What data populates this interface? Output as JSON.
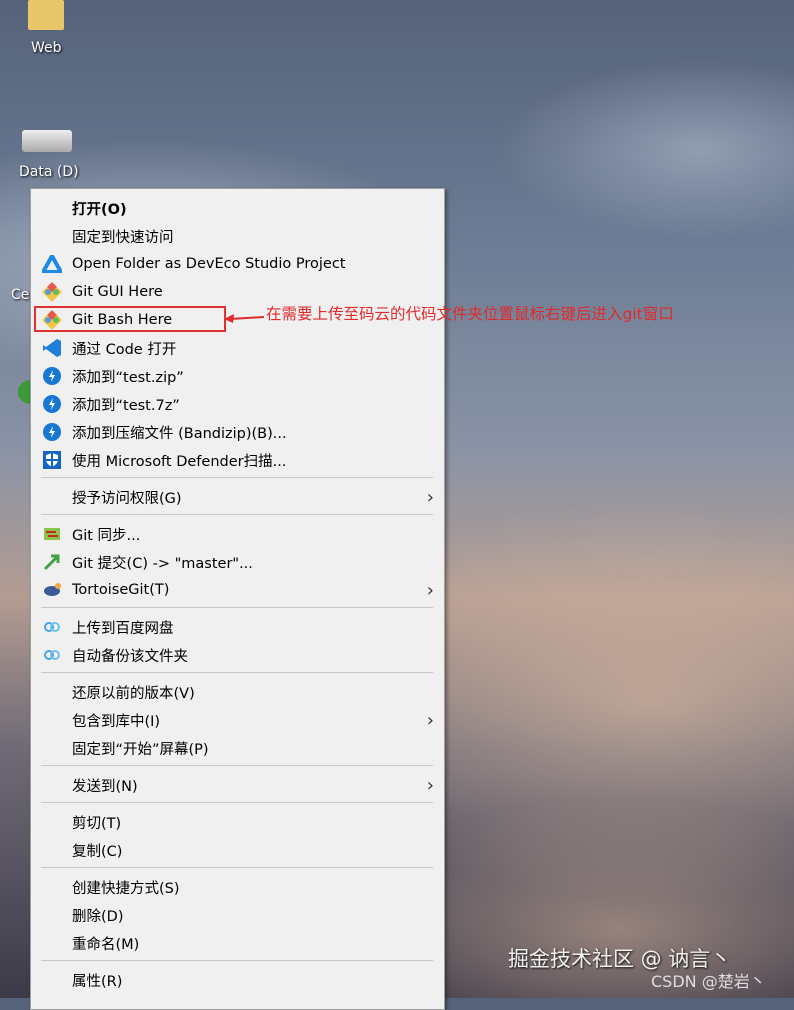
{
  "desktop": {
    "icons": [
      {
        "label": "Web"
      },
      {
        "label": "Data (D)"
      },
      {
        "label": "Ce"
      }
    ]
  },
  "menu": {
    "items": [
      {
        "type": "item",
        "label": "打开(O)",
        "bold": true,
        "icon": ""
      },
      {
        "type": "item",
        "label": "固定到快速访问",
        "icon": ""
      },
      {
        "type": "item",
        "label": "Open Folder as DevEco Studio Project",
        "icon": "deveco-icon"
      },
      {
        "type": "item",
        "label": "Git GUI Here",
        "icon": "git-icon"
      },
      {
        "type": "item",
        "label": "Git Bash Here",
        "icon": "git-icon"
      },
      {
        "type": "item",
        "label": "通过 Code 打开",
        "icon": "vscode-icon"
      },
      {
        "type": "item",
        "label": "添加到“test.zip”",
        "icon": "bandizip-icon"
      },
      {
        "type": "item",
        "label": "添加到“test.7z”",
        "icon": "bandizip-icon"
      },
      {
        "type": "item",
        "label": "添加到压缩文件 (Bandizip)(B)...",
        "icon": "bandizip-icon"
      },
      {
        "type": "item",
        "label": "使用 Microsoft Defender扫描...",
        "icon": "defender-icon"
      },
      {
        "type": "sep"
      },
      {
        "type": "item",
        "label": "授予访问权限(G)",
        "icon": "",
        "submenu": true
      },
      {
        "type": "sep"
      },
      {
        "type": "item",
        "label": "Git 同步...",
        "icon": "tortoisegit-sync-icon"
      },
      {
        "type": "item",
        "label": "Git 提交(C) -> \"master\"...",
        "icon": "tortoisegit-commit-icon"
      },
      {
        "type": "item",
        "label": "TortoiseGit(T)",
        "icon": "tortoisegit-icon",
        "submenu": true
      },
      {
        "type": "sep"
      },
      {
        "type": "item",
        "label": "上传到百度网盘",
        "icon": "baidu-netdisk-icon"
      },
      {
        "type": "item",
        "label": "自动备份该文件夹",
        "icon": "baidu-netdisk-icon"
      },
      {
        "type": "sep"
      },
      {
        "type": "item",
        "label": "还原以前的版本(V)",
        "icon": ""
      },
      {
        "type": "item",
        "label": "包含到库中(I)",
        "icon": "",
        "submenu": true
      },
      {
        "type": "item",
        "label": "固定到“开始”屏幕(P)",
        "icon": ""
      },
      {
        "type": "sep"
      },
      {
        "type": "item",
        "label": "发送到(N)",
        "icon": "",
        "submenu": true
      },
      {
        "type": "sep"
      },
      {
        "type": "item",
        "label": "剪切(T)",
        "icon": ""
      },
      {
        "type": "item",
        "label": "复制(C)",
        "icon": ""
      },
      {
        "type": "sep"
      },
      {
        "type": "item",
        "label": "创建快捷方式(S)",
        "icon": ""
      },
      {
        "type": "item",
        "label": "删除(D)",
        "icon": ""
      },
      {
        "type": "item",
        "label": "重命名(M)",
        "icon": ""
      },
      {
        "type": "sep"
      },
      {
        "type": "item",
        "label": "属性(R)",
        "icon": ""
      }
    ]
  },
  "annotation": {
    "text": "在需要上传至码云的代码文件夹位置鼠标右键后进入git窗口",
    "color": "#e02a2a"
  },
  "watermarks": {
    "juejin": "掘金技术社区 @ 讷言丶",
    "csdn": "CSDN @楚岩丶"
  }
}
